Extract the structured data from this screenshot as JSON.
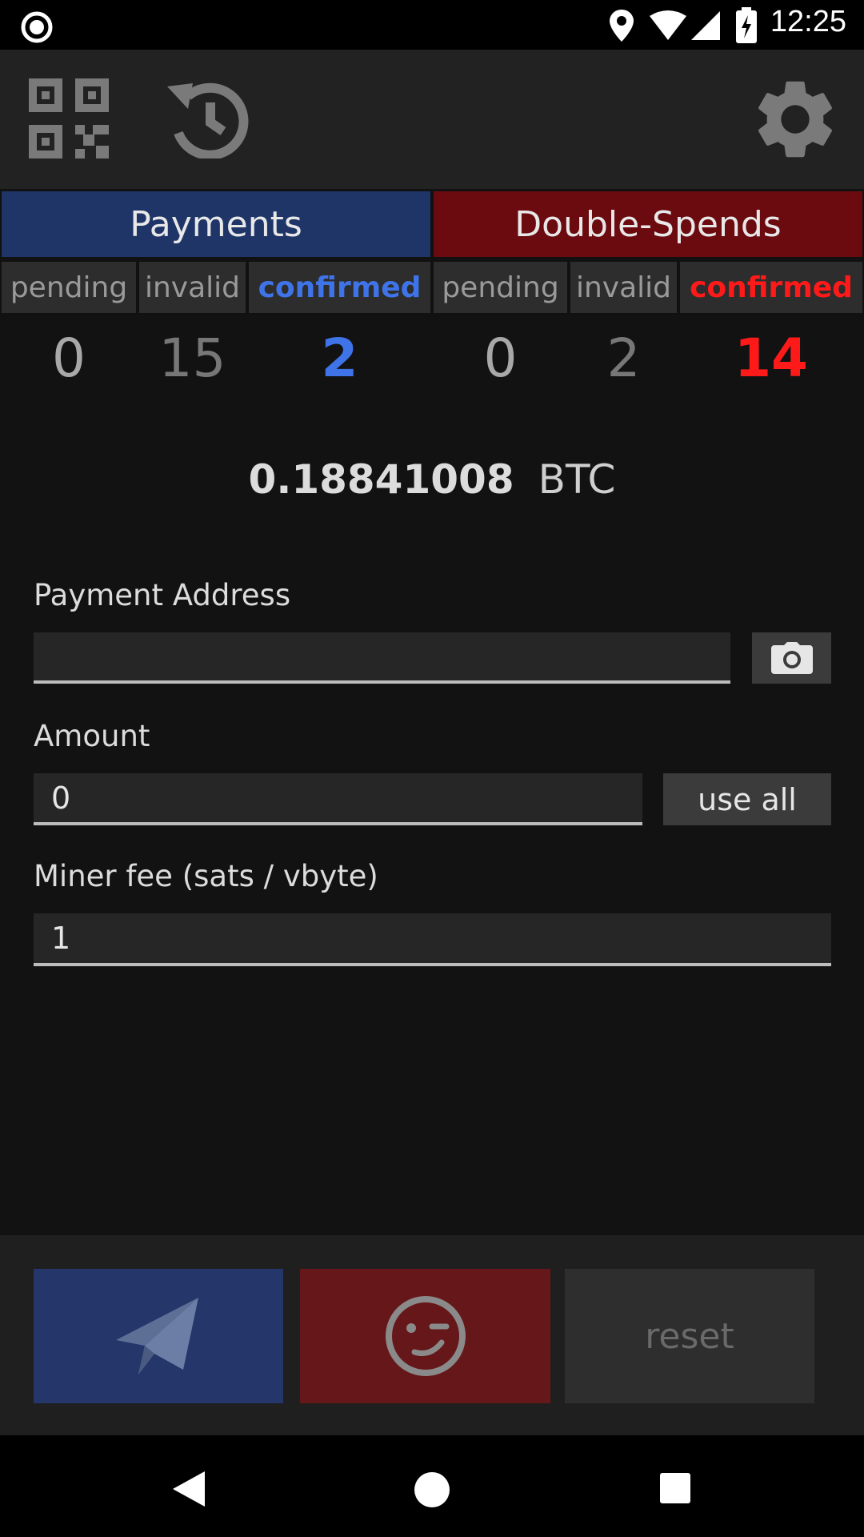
{
  "status_bar": {
    "time": "12:25"
  },
  "toolbar": {
    "qr_icon": "qr-code-icon",
    "history_icon": "history-icon",
    "settings_icon": "gear-icon"
  },
  "tabs": {
    "payments": "Payments",
    "double_spends": "Double-Spends"
  },
  "subtabs": {
    "payments": [
      "pending",
      "invalid",
      "confirmed"
    ],
    "double_spends": [
      "pending",
      "invalid",
      "confirmed"
    ]
  },
  "counts": {
    "payments": [
      "0",
      "15",
      "2"
    ],
    "double_spends": [
      "0",
      "2",
      "14"
    ]
  },
  "balance": {
    "amount": "0.18841008",
    "unit": "BTC"
  },
  "form": {
    "address_label": "Payment Address",
    "address_value": "",
    "amount_label": "Amount",
    "amount_value": "0",
    "use_all_label": "use all",
    "fee_label": "Miner fee (sats / vbyte)",
    "fee_value": "1"
  },
  "actions": {
    "send_icon": "paper-plane-icon",
    "wink_icon": "wink-face-icon",
    "reset_label": "reset"
  },
  "colors": {
    "payments_tab": "#1f3568",
    "double_spends_tab": "#6b0b0f",
    "confirmed_blue": "#3f73e8",
    "confirmed_red": "#ff1a1a",
    "send_button": "#24366a",
    "wink_button": "#661719",
    "reset_button": "#2e2e2e"
  }
}
